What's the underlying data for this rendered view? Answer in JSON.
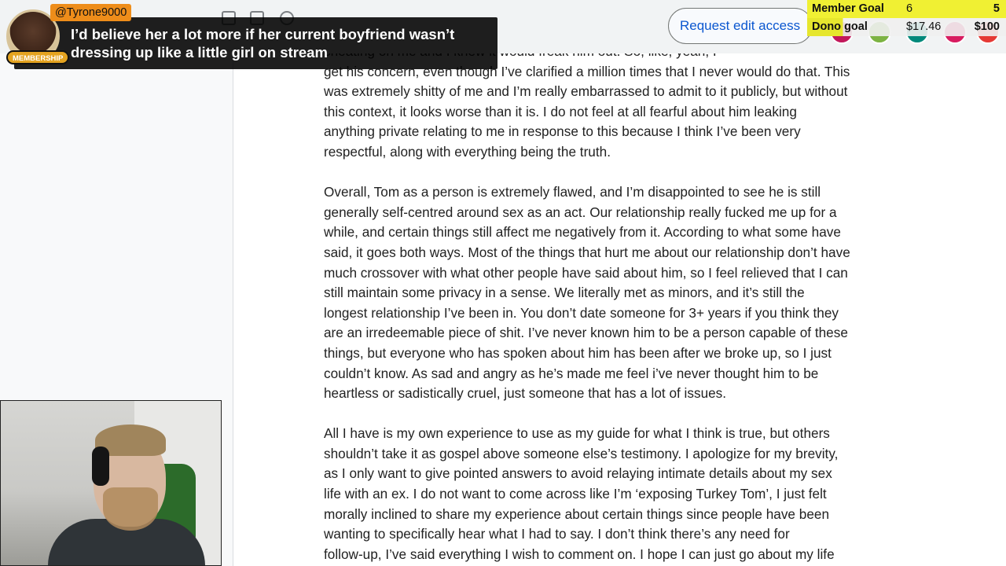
{
  "top_bar": {
    "request_button_label": "Request edit access"
  },
  "document": {
    "paragraphs": [
      "cheating on me and I knew it would freak him out. So, like, yeah, I\nget his concern, even though I’ve clarified a million times that I never would do that. This\nwas extremely shitty of me and I’m really embarrassed to admit to it publicly, but without\nthis context, it looks worse than it is. I do not feel at all fearful about him leaking\nanything private relating to me in response to this because I think I’ve been very\nrespectful, along with everything being the truth.",
      "Overall, Tom as a person is extremely flawed, and I’m disappointed to see he is still\ngenerally self-centred around sex as an act. Our relationship really fucked me up for a\nwhile, and certain things still affect me negatively from it. According to what some have\nsaid, it goes both ways. Most of the things that hurt me about our relationship don’t have\nmuch crossover with what other people have said about him, so I feel relieved that I can\nstill maintain some privacy in a sense. We literally met as minors, and it’s still the\nlongest relationship I’ve been in. You don’t date someone for 3+ years if you think they\nare an irredeemable piece of shit. I’ve never known him to be a person capable of these\nthings, but everyone who has spoken about him has been after we broke up, so I just\ncouldn’t know. As sad and angry as he’s made me feel i’ve never thought him to be\nheartless or sadistically cruel, just someone that has a lot of issues.",
      " All I have is my own experience to use as my guide for what I think is true, but others\nshouldn’t take it as gospel above someone else’s testimony. I apologize for my brevity,\nas I only want to give pointed answers to avoid relaying intimate details about my sex\nlife with an ex. I do not want to come across like I’m ‘exposing Turkey Tom’, I just felt\nmorally inclined to share my experience about certain things since people have been\nwanting to specifically hear what I had to say. I don’t think there’s any need for\nfollow-up, I’ve said everything I wish to comment on. I hope I can just go about my life"
    ]
  },
  "superchat": {
    "username": "@Tyrone9000",
    "badge": "MEMBERSHIP",
    "message": "I’d believe her a lot more if her current boyfriend wasn’t dressing up like a little girl on stream"
  },
  "goals": {
    "member": {
      "label": "Member Goal",
      "current": "6",
      "target": "5"
    },
    "dono": {
      "label": "Dono goal",
      "current": "$17.46",
      "target": "$100"
    }
  },
  "colors": {
    "request_button_text": "#0b57d0",
    "member_goal_bg": "#f0f033",
    "superchat_name_bg": "#ee8d1a",
    "membership_badge_bg": "#e4a320"
  }
}
